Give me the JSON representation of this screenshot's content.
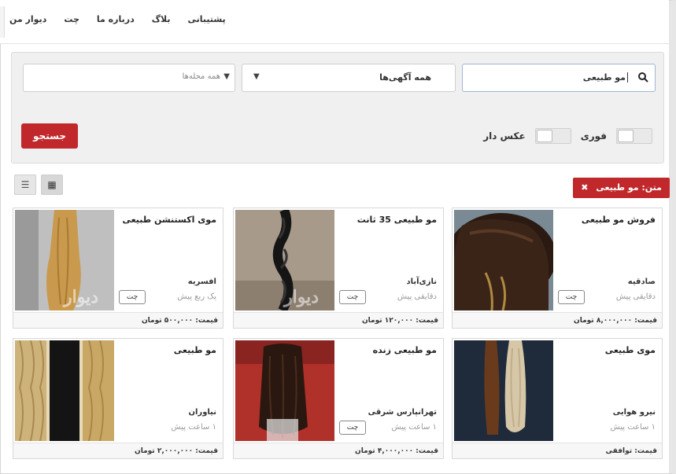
{
  "nav": {
    "links": [
      "دیوار من",
      "چت",
      "درباره ما",
      "بلاگ",
      "پشتیبانی"
    ]
  },
  "search": {
    "query": "مو طبیعی",
    "category": "همه آگهی‌ها",
    "area": "همه محله‌ها",
    "toggle_photo_label": "عکس دار",
    "toggle_photo_on": false,
    "toggle_urgent_label": "فوری",
    "toggle_urgent_on": false,
    "submit_label": "جستجو"
  },
  "filter": {
    "chip_label": "متن: مو طبیعی",
    "chip_close": "✖"
  },
  "view": {
    "list_icon": "☰",
    "grid_icon": "▦"
  },
  "cards": [
    {
      "title": "فروش مو طبیعی",
      "location": "صادقیه",
      "time": "دقایقی پیش",
      "price": "قیمت: ۸,۰۰۰,۰۰۰ تومان",
      "chat": "چت",
      "has_chat": true
    },
    {
      "title": "مو طبیعی 35 ثانت",
      "location": "نازی‌آباد",
      "time": "دقایقی پیش",
      "price": "قیمت: ۱۲۰,۰۰۰ تومان",
      "chat": "چت",
      "has_chat": true
    },
    {
      "title": "موی اکستنشن طبیعی",
      "location": "افسریه",
      "time": "یک ربع پیش",
      "price": "قیمت: ۵۰۰,۰۰۰ تومان",
      "chat": "چت",
      "has_chat": true
    },
    {
      "title": "موی طبیعی",
      "location": "نیرو هوایی",
      "time": "۱ ساعت پیش",
      "price": "قیمت: توافقی",
      "chat": "",
      "has_chat": false
    },
    {
      "title": "مو طبیعی زنده",
      "location": "تهرانپارس شرقی",
      "time": "۱ ساعت پیش",
      "price": "قیمت: ۴,۰۰۰,۰۰۰ تومان",
      "chat": "چت",
      "has_chat": true
    },
    {
      "title": "مو طبیعی",
      "location": "نیاوران",
      "time": "۱ ساعت پیش",
      "price": "قیمت: ۲,۰۰۰,۰۰۰ تومان",
      "chat": "",
      "has_chat": false
    }
  ],
  "watermark": "دیوار"
}
